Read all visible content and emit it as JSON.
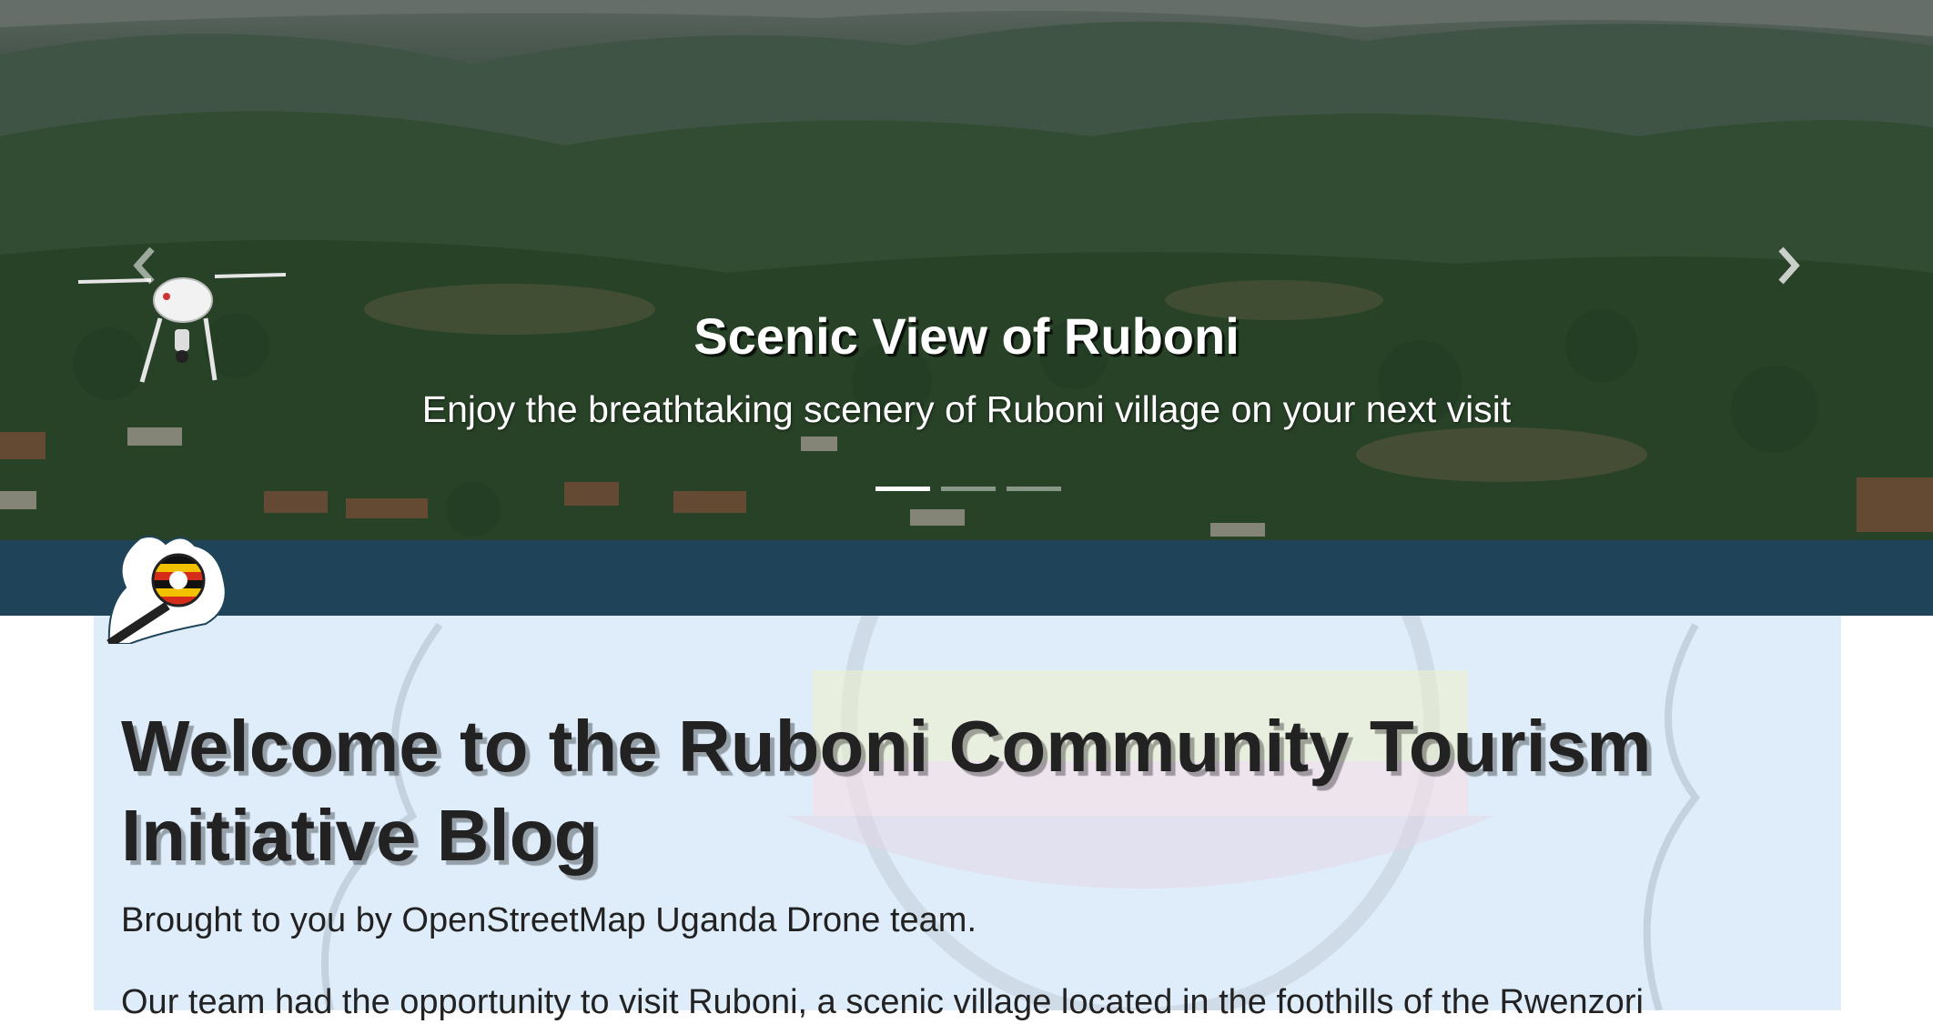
{
  "carousel": {
    "slide_title": "Scenic View of Ruboni",
    "slide_subtitle": "Enjoy the breathtaking scenery of Ruboni village on your next visit",
    "slide_count": 3,
    "active_slide": 1,
    "prev_icon": "chevron-left-icon",
    "next_icon": "chevron-right-icon"
  },
  "nav": {
    "logo_icon": "uganda-flag-magnifier-logo"
  },
  "blog": {
    "title": "Welcome to the Ruboni Community Tourism Initiative Blog",
    "byline": "Brought to you by OpenStreetMap Uganda Drone team.",
    "intro": "Our team had the opportunity to visit Ruboni, a scenic village located in the foothills of the Rwenzori"
  },
  "colors": {
    "nav_band": "#1f4459",
    "card_background": "#dfedfb",
    "text": "#222222"
  }
}
